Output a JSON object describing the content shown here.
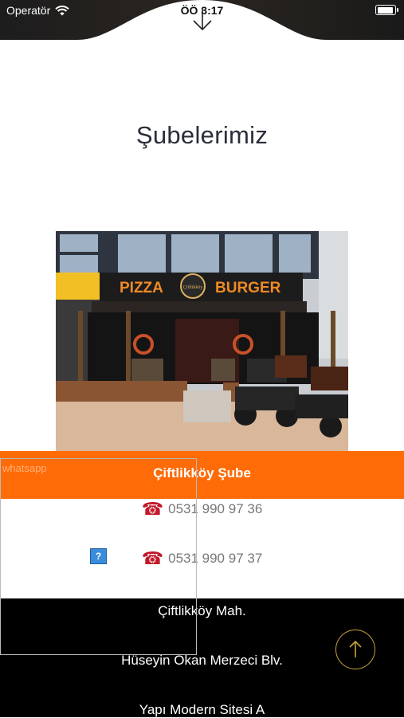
{
  "status_bar": {
    "carrier": "Operatör",
    "time": "ÖÖ 3:17"
  },
  "icons": {
    "wifi": "wifi-icon",
    "battery": "battery-icon",
    "scroll_down": "arrow-down-icon",
    "phone": "telephone-icon",
    "broken_image": "question-mark-icon",
    "scroll_top": "arrow-up-icon"
  },
  "page": {
    "title": "Şubelerimiz"
  },
  "photo": {
    "sign_left": "PIZZA",
    "sign_right": "BURGER",
    "logo_text": "Çiftlikköy"
  },
  "branch": {
    "name": "Çiftlikköy Şube",
    "phones": [
      "0531 990 97 36",
      "0531 990 97 37"
    ],
    "address_lines": [
      "Çiftlikköy Mah.",
      "Hüseyin Okan Merzeci Blv.",
      "Yapı Modern Sitesi A"
    ]
  },
  "whatsapp": {
    "label": "whatsapp",
    "broken_glyph": "?"
  },
  "colors": {
    "accent": "#ff6b07",
    "title_text": "#2a2e3a",
    "phone_text": "#777777",
    "footer_bg": "#000000",
    "scroll_button_ring": "#c9a23c"
  }
}
